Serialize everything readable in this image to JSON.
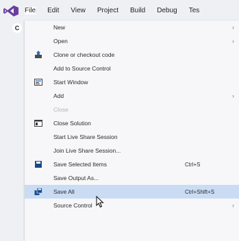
{
  "menubar": {
    "logo": "visual-studio-logo",
    "items": [
      {
        "label": "File"
      },
      {
        "label": "Edit"
      },
      {
        "label": "View"
      },
      {
        "label": "Project"
      },
      {
        "label": "Build"
      },
      {
        "label": "Debug"
      },
      {
        "label": "Tes"
      }
    ]
  },
  "side": {
    "badge": "C"
  },
  "file_menu": {
    "items": [
      {
        "label": "New",
        "has_submenu": true,
        "arrow": "›"
      },
      {
        "label": "Open",
        "has_submenu": true,
        "arrow": "›"
      },
      {
        "label": "Clone or checkout code",
        "icon": "clone-icon"
      },
      {
        "label": "Add to Source Control"
      },
      {
        "label": "Start Window",
        "icon": "start-window-icon"
      },
      {
        "label": "Add",
        "has_submenu": true,
        "arrow": "›"
      },
      {
        "label": "Close",
        "disabled": true
      },
      {
        "label": "Close Solution",
        "icon": "close-solution-icon"
      },
      {
        "label": "Start Live Share Session"
      },
      {
        "label": "Join Live Share Session..."
      },
      {
        "label": "Save Selected Items",
        "shortcut": "Ctrl+S",
        "icon": "save-icon"
      },
      {
        "label": "Save Output As..."
      },
      {
        "label": "Save All",
        "shortcut": "Ctrl+Shift+S",
        "icon": "save-all-icon",
        "highlighted": true
      },
      {
        "label": "Source Control",
        "has_submenu": true,
        "arrow": "›"
      }
    ]
  },
  "colors": {
    "menubar_bg": "#eef0f4",
    "menu_bg": "#f7f7f9",
    "highlight": "#c9dcf3",
    "logo_purple": "#6a3f9e",
    "icon_blue": "#1a4e8c"
  }
}
